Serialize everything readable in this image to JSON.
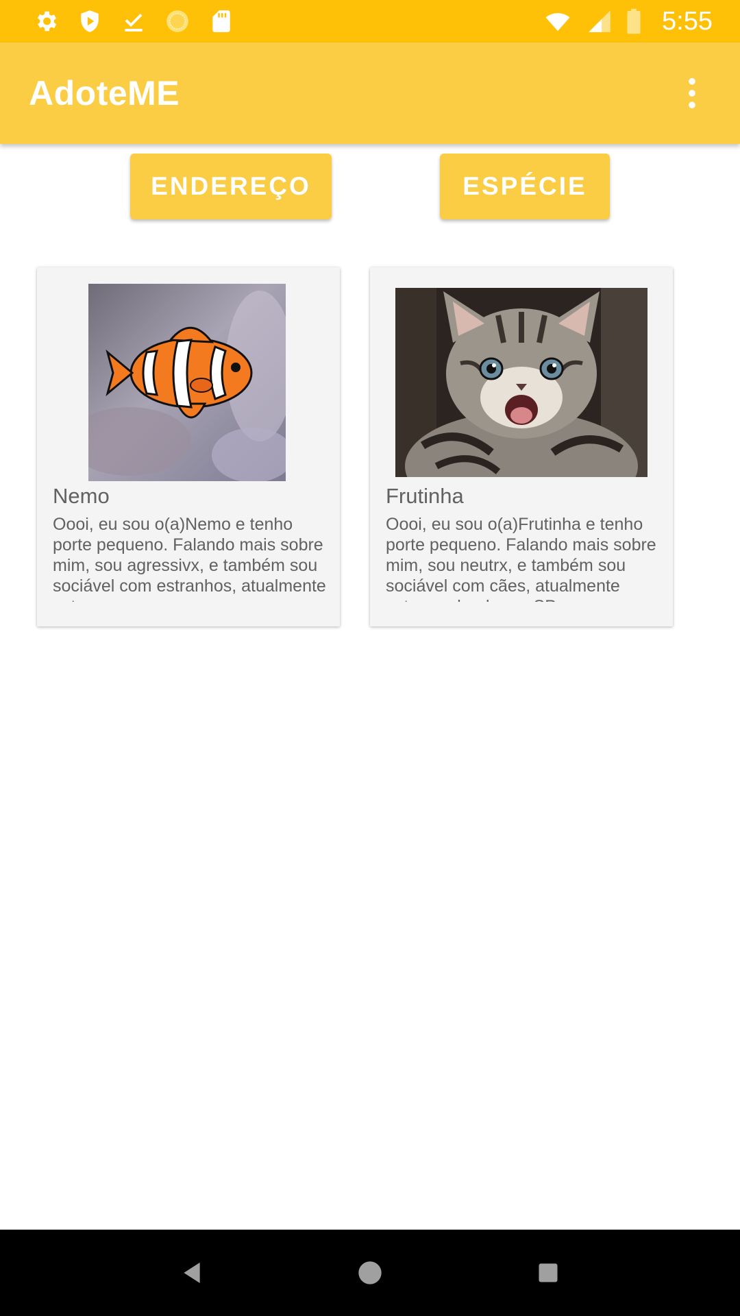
{
  "status_bar": {
    "time": "5:55",
    "left_icons": [
      "settings-icon",
      "shield-icon",
      "download-done-icon",
      "sun-icon",
      "sd-card-icon"
    ],
    "right_icons": [
      "wifi-icon",
      "signal-icon",
      "battery-icon"
    ]
  },
  "app_bar": {
    "title": "AdoteME",
    "menu_icon": "more-vert-icon"
  },
  "filters": {
    "endereco_label": "ENDEREÇO",
    "especie_label": "ESPÉCIE"
  },
  "pets": [
    {
      "name": "Nemo",
      "description": "Oooi, eu sou o(a)Nemo e tenho porte pequeno. Falando mais sobre mim, sou agressivx, e também sou sociável com estranhos, atualmente estou",
      "image": "clownfish-photo"
    },
    {
      "name": "Frutinha",
      "description": "Oooi, eu sou o(a)Frutinha e tenho porte pequeno. Falando mais sobre mim, sou neutrx, e também sou sociável com cães, atualmente estou andando por SP",
      "image": "kitten-photo"
    }
  ],
  "colors": {
    "status_bar": "#FFC107",
    "primary": "#FBCD44",
    "card_bg": "#F4F4F4",
    "text_secondary": "#616161"
  },
  "nav_bar": {
    "icons": [
      "back-icon",
      "home-icon",
      "recents-icon"
    ]
  }
}
